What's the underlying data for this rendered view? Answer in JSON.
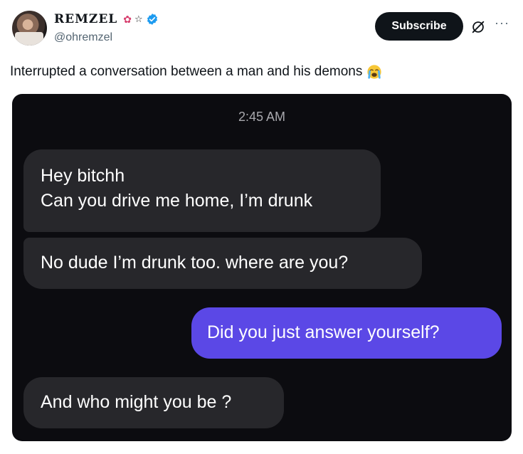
{
  "post": {
    "display_name": "REMZEL",
    "handle": "@ohremzel",
    "subscribe_label": "Subscribe",
    "more_label": "···",
    "text": "Interrupted a conversation between a man and his demons",
    "icons": {
      "rose": "rose-icon",
      "star": "star-icon",
      "verified": "verified-icon",
      "grok": "slashed-circle-icon",
      "more": "more-icon",
      "emoji": "loudly-crying-face-icon"
    },
    "colors": {
      "verified": "#1d9bf0",
      "subscribe_bg": "#0f1419",
      "outgoing_bubble": "#5b48e6",
      "incoming_bubble": "#27272b",
      "chat_bg": "#0c0c10"
    }
  },
  "chat": {
    "timestamp": "2:45 AM",
    "messages": [
      {
        "lines": [
          "Hey bitchh",
          "Can you drive me home, I’m drunk"
        ],
        "side": "incoming"
      },
      {
        "text": "No dude I’m drunk too. where are you?",
        "side": "incoming"
      },
      {
        "text": "Did you just answer yourself?",
        "side": "outgoing"
      },
      {
        "text": "And who might you be ?",
        "side": "incoming"
      }
    ]
  }
}
